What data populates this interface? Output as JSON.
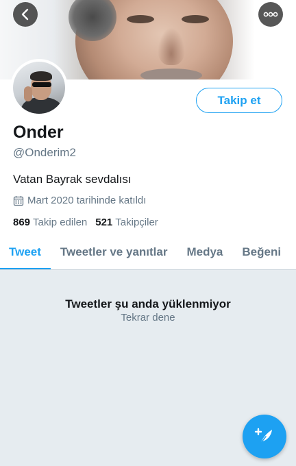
{
  "profile": {
    "name": "Onder",
    "handle": "@Onderim2",
    "bio": "Vatan Bayrak sevdalısı",
    "joined": "Mart 2020 tarihinde katıldı",
    "following_count": "869",
    "following_label": "Takip edilen",
    "followers_count": "521",
    "followers_label": "Takipçiler",
    "follow_button_label": "Takip et"
  },
  "tabs": [
    {
      "label": "Tweet",
      "active": true
    },
    {
      "label": "Tweetler ve yanıtlar",
      "active": false
    },
    {
      "label": "Medya",
      "active": false
    },
    {
      "label": "Beğeni",
      "active": false
    }
  ],
  "feed": {
    "error_title": "Tweetler şu anda yüklenmiyor",
    "retry_label": "Tekrar dene"
  },
  "icons": {
    "back": "chevron-left-icon",
    "more": "more-horizontal-icon",
    "calendar": "calendar-icon",
    "compose": "compose-tweet-icon"
  },
  "colors": {
    "accent": "#1da1f2",
    "secondary_text": "#657786",
    "primary_text": "#14171a",
    "feed_background": "#e6ecf0"
  }
}
